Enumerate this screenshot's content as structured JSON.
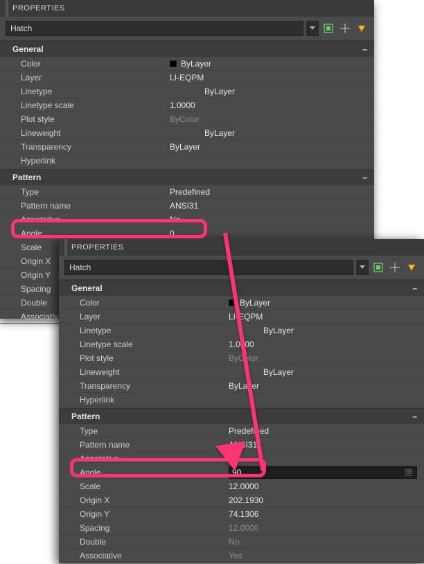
{
  "panels": {
    "back": {
      "title": "PROPERTIES",
      "object_type": "Hatch",
      "sections": {
        "general": {
          "label": "General",
          "color": {
            "label": "Color",
            "value": "ByLayer"
          },
          "layer": {
            "label": "Layer",
            "value": "LI-EQPM"
          },
          "linetype": {
            "label": "Linetype",
            "value": "ByLayer"
          },
          "linetype_scale": {
            "label": "Linetype scale",
            "value": "1.0000"
          },
          "plot_style": {
            "label": "Plot style",
            "value": "ByColor"
          },
          "lineweight": {
            "label": "Lineweight",
            "value": "ByLayer"
          },
          "transparency": {
            "label": "Transparency",
            "value": "ByLayer"
          },
          "hyperlink": {
            "label": "Hyperlink",
            "value": ""
          }
        },
        "pattern": {
          "label": "Pattern",
          "type": {
            "label": "Type",
            "value": "Predefined"
          },
          "pattern_name": {
            "label": "Pattern name",
            "value": "ANSI31"
          },
          "annotative": {
            "label": "Annotative",
            "value": "No"
          },
          "angle": {
            "label": "Angle",
            "value": "0"
          },
          "scale": {
            "label": "Scale",
            "value": ""
          },
          "origin_x": {
            "label": "Origin X",
            "value": ""
          },
          "origin_y": {
            "label": "Origin Y",
            "value": ""
          },
          "spacing": {
            "label": "Spacing",
            "value": ""
          },
          "double": {
            "label": "Double",
            "value": ""
          },
          "associative": {
            "label": "Associativ",
            "value": ""
          }
        }
      }
    },
    "front": {
      "title": "PROPERTIES",
      "object_type": "Hatch",
      "sections": {
        "general": {
          "label": "General",
          "color": {
            "label": "Color",
            "value": "ByLayer"
          },
          "layer": {
            "label": "Layer",
            "value": "LI-EQPM"
          },
          "linetype": {
            "label": "Linetype",
            "value": "ByLayer"
          },
          "linetype_scale": {
            "label": "Linetype scale",
            "value": "1.0000"
          },
          "plot_style": {
            "label": "Plot style",
            "value": "ByColor"
          },
          "lineweight": {
            "label": "Lineweight",
            "value": "ByLayer"
          },
          "transparency": {
            "label": "Transparency",
            "value": "ByLayer"
          },
          "hyperlink": {
            "label": "Hyperlink",
            "value": ""
          }
        },
        "pattern": {
          "label": "Pattern",
          "type": {
            "label": "Type",
            "value": "Predefined"
          },
          "pattern_name": {
            "label": "Pattern name",
            "value": "ANSI31"
          },
          "annotative": {
            "label": "Annotative",
            "value": "No"
          },
          "angle": {
            "label": "Angle",
            "value": "90"
          },
          "scale": {
            "label": "Scale",
            "value": "12.0000"
          },
          "origin_x": {
            "label": "Origin X",
            "value": "202.1930"
          },
          "origin_y": {
            "label": "Origin Y",
            "value": "74.1306"
          },
          "spacing": {
            "label": "Spacing",
            "value": "12.0000"
          },
          "double": {
            "label": "Double",
            "value": "No"
          },
          "associative": {
            "label": "Associative",
            "value": "Yes"
          }
        }
      }
    }
  },
  "collapse_glyph": "–",
  "icons": {
    "toggle_pim": "toggle-pim-icon",
    "quick_select": "quick-select-icon",
    "select_objects": "select-objects-icon"
  }
}
